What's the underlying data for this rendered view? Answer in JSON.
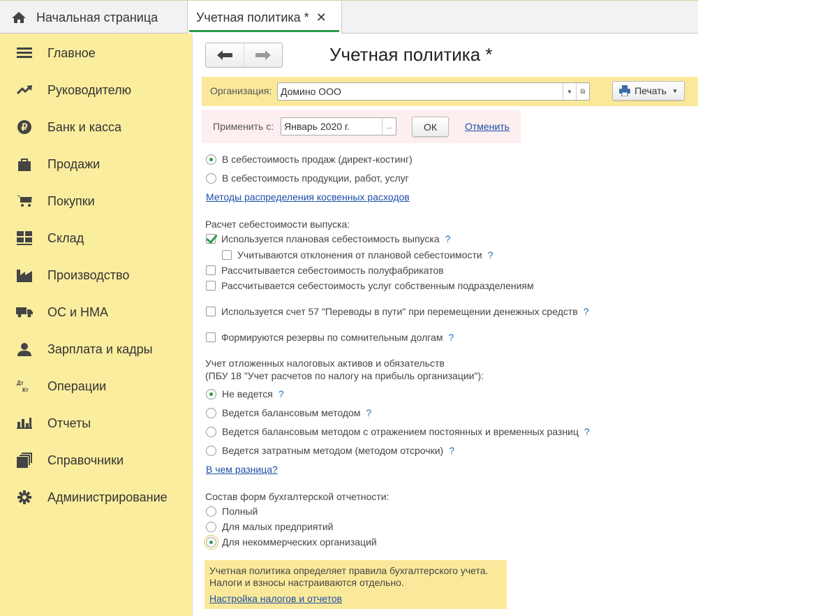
{
  "tabs": {
    "home": "Начальная страница",
    "doc": "Учетная политика *",
    "close": "✕"
  },
  "sidebar": {
    "items": [
      {
        "label": "Главное",
        "icon": "menu-icon"
      },
      {
        "label": "Руководителю",
        "icon": "trend-icon"
      },
      {
        "label": "Банк и касса",
        "icon": "ruble-icon"
      },
      {
        "label": "Продажи",
        "icon": "bag-icon"
      },
      {
        "label": "Покупки",
        "icon": "cart-icon"
      },
      {
        "label": "Склад",
        "icon": "warehouse-icon"
      },
      {
        "label": "Производство",
        "icon": "factory-icon"
      },
      {
        "label": "ОС и НМА",
        "icon": "truck-icon"
      },
      {
        "label": "Зарплата и кадры",
        "icon": "person-icon"
      },
      {
        "label": "Операции",
        "icon": "dt-kt-icon"
      },
      {
        "label": "Отчеты",
        "icon": "bar-chart-icon"
      },
      {
        "label": "Справочники",
        "icon": "books-icon"
      },
      {
        "label": "Администрирование",
        "icon": "gear-icon"
      }
    ]
  },
  "header": {
    "title": "Учетная политика *"
  },
  "org": {
    "label": "Организация:",
    "value": "Домино ООО",
    "print": "Печать"
  },
  "apply": {
    "label": "Применить с:",
    "value": "Январь 2020 г.",
    "ellipsis": "...",
    "ok": "ОК",
    "cancel": "Отменить"
  },
  "form": {
    "r_direct": "В себестоимость продаж (директ-костинг)",
    "r_products": "В  себестоимость продукции, работ, услуг",
    "link_methods": "Методы распределения косвенных расходов",
    "h_cost": "Расчет себестоимости выпуска:",
    "cb_planned": "Используется плановая себестоимость выпуска",
    "cb_deviations": "Учитываются отклонения от плановой себестоимости",
    "cb_semi": "Рассчитывается себестоимость полуфабрикатов",
    "cb_services": "Рассчитывается себестоимость услуг собственным подразделениям",
    "cb_57": "Используется счет 57 \"Переводы в пути\" при перемещении денежных средств",
    "cb_reserves": "Формируются резервы по сомнительным долгам",
    "h_tax1": "Учет отложенных налоговых активов и обязательств",
    "h_tax2": "(ПБУ 18 \"Учет расчетов по налогу на прибыль организации\"):",
    "r_none": "Не ведется",
    "r_balance": "Ведется балансовым методом",
    "r_balance_diff": "Ведется балансовым методом с отражением постоянных и временных разниц",
    "r_cost": "Ведется затратным методом (методом отсрочки)",
    "link_diff": "В чем разница?",
    "h_forms": "Состав форм бухгалтерской отчетности:",
    "r_full": "Полный",
    "r_small": "Для малых предприятий",
    "r_nonprofit": "Для некоммерческих организаций",
    "help": "?"
  },
  "info": {
    "line1": "Учетная политика определяет правила бухгалтерского учета.",
    "line2": "Налоги и взносы настраиваются отдельно.",
    "link": "Настройка налогов и отчетов"
  }
}
